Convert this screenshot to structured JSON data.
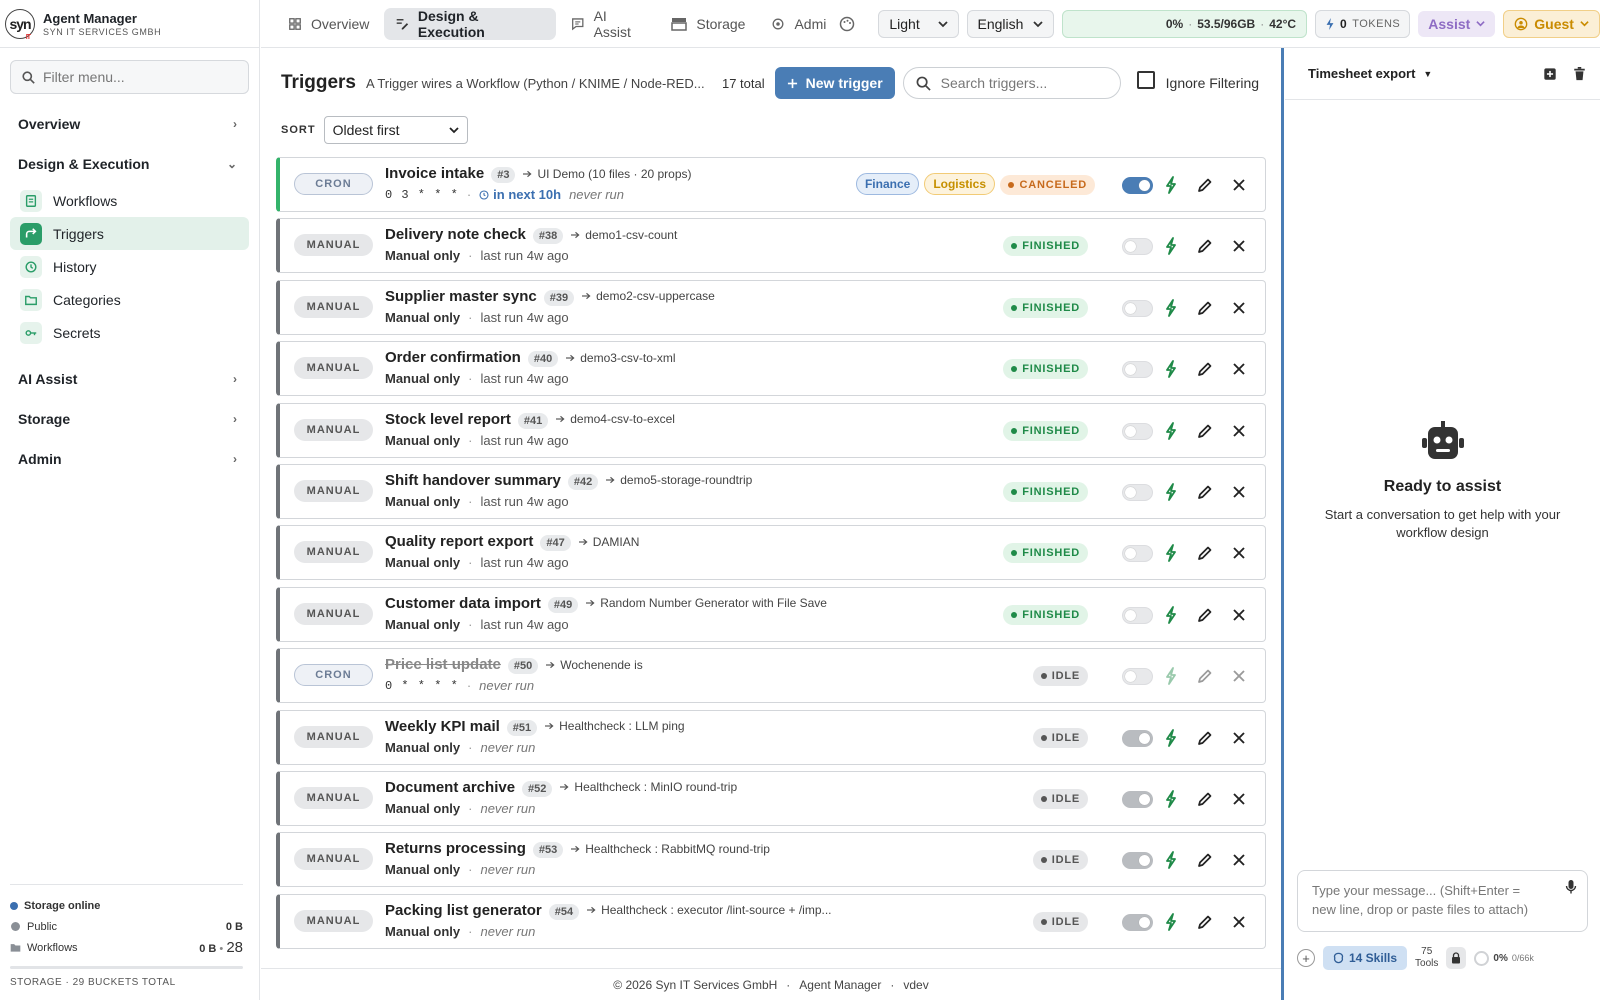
{
  "brand": {
    "logo": "syn",
    "logo_sub": "IT",
    "title": "Agent Manager",
    "subtitle": "SYN IT SERVICES GMBH"
  },
  "sidebar": {
    "filter_placeholder": "Filter menu...",
    "groups": [
      {
        "label": "Overview"
      },
      {
        "label": "Design & Execution"
      },
      {
        "label": "AI Assist"
      },
      {
        "label": "Storage"
      },
      {
        "label": "Admin"
      }
    ],
    "items": [
      {
        "label": "Workflows",
        "icon": "workflows-icon"
      },
      {
        "label": "Triggers",
        "icon": "trigger-icon",
        "active": true
      },
      {
        "label": "History",
        "icon": "history-icon"
      },
      {
        "label": "Categories",
        "icon": "folder-icon"
      },
      {
        "label": "Secrets",
        "icon": "key-icon"
      }
    ],
    "footer": {
      "status": "Storage online",
      "public_label": "Public",
      "public_value": "0 B",
      "workflows_label": "Workflows",
      "workflows_value": "0 B",
      "workflows_count": "28",
      "caption": "STORAGE · 29 BUCKETS TOTAL"
    }
  },
  "topbar": {
    "tabs": [
      {
        "label": "Overview"
      },
      {
        "label": "Design & Execution",
        "active": true
      },
      {
        "label": "AI Assist"
      },
      {
        "label": "Storage"
      },
      {
        "label": "Admi"
      }
    ],
    "theme": "Light",
    "language": "English",
    "health": {
      "cpu": "0%",
      "sep1": "·",
      "mem": "53.5/96GB",
      "sep2": "·",
      "temp": "42°C"
    },
    "tokens": {
      "value": "0",
      "label": "TOKENS"
    },
    "assist": "Assist",
    "guest": "Guest"
  },
  "main": {
    "title": "Triggers",
    "description": "A Trigger wires a Workflow (Python / KNIME / Node-RED...",
    "total": "17 total",
    "new_button": "New trigger",
    "search_placeholder": "Search triggers...",
    "ignore_filtering": "Ignore Filtering",
    "sort_label": "SORT",
    "sort_value": "Oldest first",
    "footer": {
      "copyright": "© 2026 Syn IT Services GmbH",
      "app": "Agent Manager",
      "version": "vdev",
      "dot": "·"
    },
    "triggers": [
      {
        "kind": "CRON",
        "name": "Invoice intake",
        "id": "#3",
        "target": "UI Demo (10 files · 20 props)",
        "schedule": "0 3 * * *",
        "next": "in next 10h",
        "lastrun": "never run",
        "status": "CANCELED",
        "tags": [
          "Finance",
          "Logistics"
        ],
        "enabled": true
      },
      {
        "kind": "MANUAL",
        "name": "Delivery note check",
        "id": "#38",
        "target": "demo1-csv-count",
        "schedule": "Manual only",
        "lastrun": "last run 4w ago",
        "status": "FINISHED",
        "enabled": false
      },
      {
        "kind": "MANUAL",
        "name": "Supplier master sync",
        "id": "#39",
        "target": "demo2-csv-uppercase",
        "schedule": "Manual only",
        "lastrun": "last run 4w ago",
        "status": "FINISHED",
        "enabled": false
      },
      {
        "kind": "MANUAL",
        "name": "Order confirmation",
        "id": "#40",
        "target": "demo3-csv-to-xml",
        "schedule": "Manual only",
        "lastrun": "last run 4w ago",
        "status": "FINISHED",
        "enabled": false
      },
      {
        "kind": "MANUAL",
        "name": "Stock level report",
        "id": "#41",
        "target": "demo4-csv-to-excel",
        "schedule": "Manual only",
        "lastrun": "last run 4w ago",
        "status": "FINISHED",
        "enabled": false
      },
      {
        "kind": "MANUAL",
        "name": "Shift handover summary",
        "id": "#42",
        "target": "demo5-storage-roundtrip",
        "schedule": "Manual only",
        "lastrun": "last run 4w ago",
        "status": "FINISHED",
        "enabled": false
      },
      {
        "kind": "MANUAL",
        "name": "Quality report export",
        "id": "#47",
        "target": "DAMIAN",
        "schedule": "Manual only",
        "lastrun": "last run 4w ago",
        "status": "FINISHED",
        "enabled": false
      },
      {
        "kind": "MANUAL",
        "name": "Customer data import",
        "id": "#49",
        "target": "Random Number Generator with File Save",
        "schedule": "Manual only",
        "lastrun": "last run 4w ago",
        "status": "FINISHED",
        "enabled": false
      },
      {
        "kind": "CRON",
        "name": "Price list update",
        "id": "#50",
        "target": "Wochenende is",
        "schedule": "0 * * * *",
        "lastrun": "never run",
        "status": "IDLE",
        "enabled": false,
        "muted": true
      },
      {
        "kind": "MANUAL",
        "name": "Weekly KPI mail",
        "id": "#51",
        "target": "Healthcheck : LLM ping",
        "schedule": "Manual only",
        "lastrun": "never run",
        "status": "IDLE",
        "enabled": false,
        "locked": true
      },
      {
        "kind": "MANUAL",
        "name": "Document archive",
        "id": "#52",
        "target": "Healthcheck : MinIO round-trip",
        "schedule": "Manual only",
        "lastrun": "never run",
        "status": "IDLE",
        "enabled": false,
        "locked": true
      },
      {
        "kind": "MANUAL",
        "name": "Returns processing",
        "id": "#53",
        "target": "Healthcheck : RabbitMQ round-trip",
        "schedule": "Manual only",
        "lastrun": "never run",
        "status": "IDLE",
        "enabled": false,
        "locked": true
      },
      {
        "kind": "MANUAL",
        "name": "Packing list generator",
        "id": "#54",
        "target": "Healthcheck : executor /lint-source + /imp...",
        "schedule": "Manual only",
        "lastrun": "never run",
        "status": "IDLE",
        "enabled": false,
        "locked": true
      }
    ]
  },
  "panel": {
    "title": "Timesheet export",
    "ready_title": "Ready to assist",
    "ready_sub": "Start a conversation to get help with your workflow design",
    "placeholder": "Type your message... (Shift+Enter = new line, drop or paste files to attach)",
    "skills": "14 Skills",
    "tools_count": "75",
    "tools_label": "Tools",
    "usage": "0%",
    "usage_cap": "0/66k"
  },
  "colors": {
    "accent": "#4a7db5",
    "active_nav": "#2a9d68",
    "finished": "#1f8a48",
    "canceled": "#c76a1c",
    "active_row": "#34b36b"
  }
}
